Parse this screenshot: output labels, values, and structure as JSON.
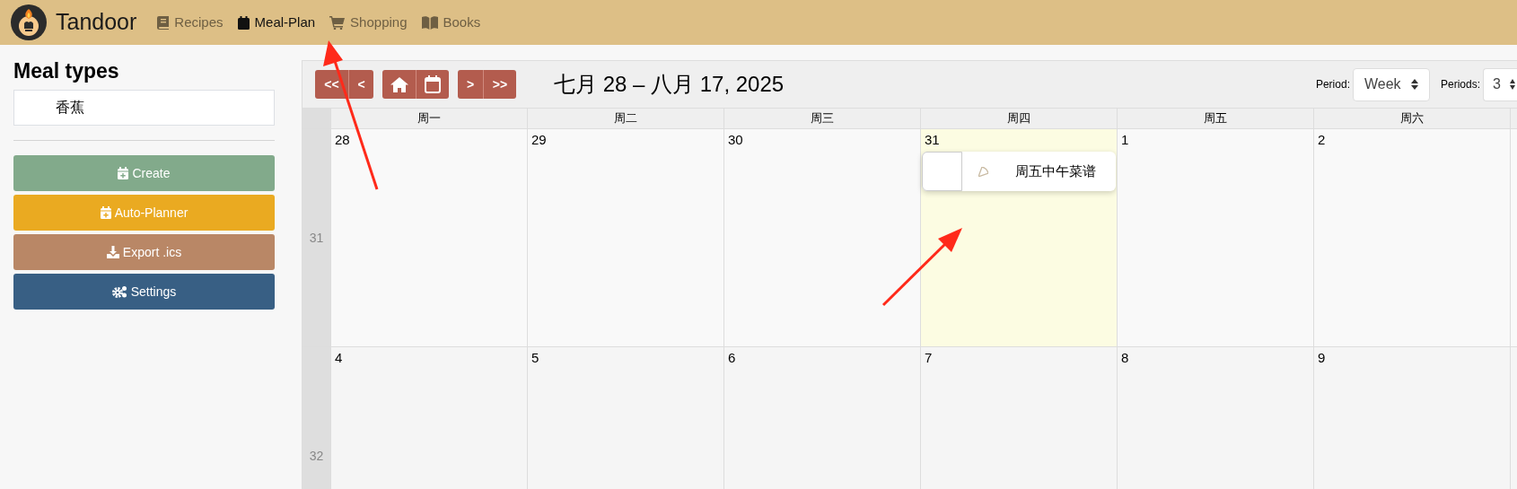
{
  "brand": "Tandoor",
  "nav": [
    {
      "label": "Recipes",
      "selected": false
    },
    {
      "label": "Meal-Plan",
      "selected": true
    },
    {
      "label": "Shopping",
      "selected": false
    },
    {
      "label": "Books",
      "selected": false
    }
  ],
  "sidebar": {
    "title": "Meal types",
    "meal_types": [
      "香蕉"
    ],
    "buttons": [
      {
        "label": "Create",
        "color": "#82aa8b"
      },
      {
        "label": "Auto-Planner",
        "color": "#eaaa21"
      },
      {
        "label": "Export .ics",
        "color": "#b98766"
      },
      {
        "label": "Settings",
        "color": "#385f84"
      }
    ]
  },
  "toolbar": {
    "nav_buttons": [
      [
        {
          "kind": "text",
          "label": "<<"
        },
        {
          "kind": "text",
          "label": "<"
        }
      ],
      [
        {
          "kind": "home"
        },
        {
          "kind": "calendar"
        }
      ],
      [
        {
          "kind": "text",
          "label": ">"
        },
        {
          "kind": "text",
          "label": ">>"
        }
      ]
    ],
    "range": "七月 28 – 八月 17, 2025",
    "period_label": "Period:",
    "period_value": "Week",
    "periods_label": "Periods:",
    "periods_value": "3"
  },
  "calendar": {
    "weekdays": [
      "周一",
      "周二",
      "周三",
      "周四",
      "周五",
      "周六"
    ],
    "weeks": [
      {
        "number": "31",
        "days": [
          {
            "date": "28",
            "today": false
          },
          {
            "date": "29",
            "today": false
          },
          {
            "date": "30",
            "today": false
          },
          {
            "date": "31",
            "today": true,
            "entries": [
              {
                "title": "周五中午菜谱"
              }
            ]
          },
          {
            "date": "1",
            "today": false
          },
          {
            "date": "2",
            "today": false
          }
        ]
      },
      {
        "number": "32",
        "days": [
          {
            "date": "4",
            "today": false
          },
          {
            "date": "5",
            "today": false
          },
          {
            "date": "6",
            "today": false
          },
          {
            "date": "7",
            "today": false
          },
          {
            "date": "8",
            "today": false
          },
          {
            "date": "9",
            "today": false
          }
        ]
      }
    ]
  }
}
